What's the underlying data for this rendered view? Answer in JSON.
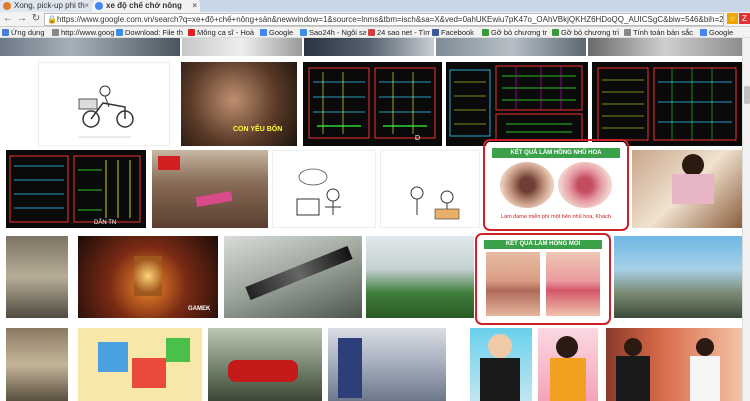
{
  "browser": {
    "tabs": [
      {
        "title": "Xong, pick-up phi th"
      },
      {
        "title": "xe độ chế chở nông"
      }
    ],
    "url": "https://www.google.com.vn/search?q=xe+độ+chế+nông+sản&newwindow=1&source=lnms&tbm=isch&sa=X&ved=0ahUKEwiu7pK47o_OAhVBkjQKHZ6HDoQQ_AUICSgC&biw=546&bih=256#ne"
  },
  "bookmarks": [
    {
      "label": "Ứng dụng",
      "color": "#4a7fd4"
    },
    {
      "label": "http://www.google",
      "color": "#888888"
    },
    {
      "label": "Download: File th",
      "color": "#3a8ee6"
    },
    {
      "label": "Mông ca sĩ - Hoà",
      "color": "#e02020"
    },
    {
      "label": "Google",
      "color": "#4285f4"
    },
    {
      "label": "Sao24h - Ngôi sa",
      "color": "#3a8ee6"
    },
    {
      "label": "24 sao net - Tìm",
      "color": "#d04040"
    },
    {
      "label": "Facebook",
      "color": "#3b5998"
    },
    {
      "label": "Gỡ bỏ chương tr",
      "color": "#3a9a3a"
    },
    {
      "label": "Gỡ bỏ chương trì",
      "color": "#3a9a3a"
    },
    {
      "label": "Tính toán bản sắc",
      "color": "#888888"
    },
    {
      "label": "Google",
      "color": "#4285f4"
    }
  ],
  "results": {
    "overlay_texts": {
      "lam_hong_nhu_hoa": "KẾT QUẢ LÀM HỒNG NHŨ HOA",
      "lam_hong_moi": "KẾT QUẢ LÀM HỒNG MÔI",
      "nhu_hoa_caption": "Làm dame miễn phí một bên nhũ hoa, Khách",
      "con_yeu_bon": "CON YÊU BỐN",
      "gamek": "GAMEK",
      "dan_tn": "DẪN TN"
    }
  }
}
